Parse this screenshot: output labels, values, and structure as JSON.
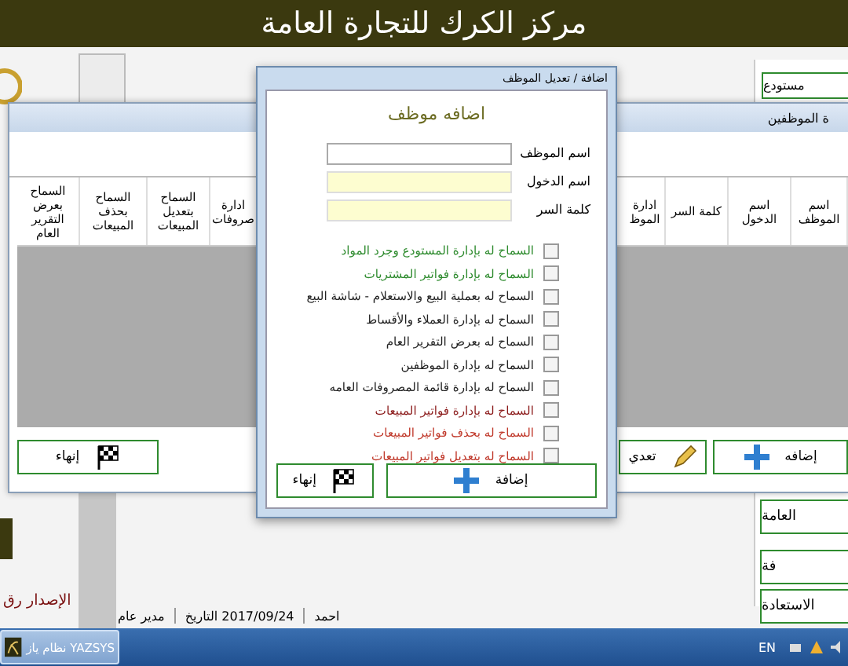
{
  "header": {
    "title": "مركز الكرك للتجارة العامة"
  },
  "background": {
    "version_text": "الإصدار رق",
    "right_panel": {
      "field_value": "مستودع",
      "buttons": [
        "العامة",
        "فة",
        "الاستعادة"
      ]
    },
    "status_bar": {
      "user": "احمد",
      "date": "2017/09/24 التاريخ",
      "role": "مدير عام"
    }
  },
  "employees_window": {
    "title": "ة الموظفين",
    "columns_right": [
      "اسم الموظف",
      "اسم الدخول",
      "كلمة السر",
      "ادارة الموظ"
    ],
    "columns_left": [
      "ادارة صروفات",
      "السماح بتعديل المبيعات",
      "السماح بحذف المبيعات",
      "السماح بعرض التقرير العام"
    ],
    "buttons": [
      {
        "kind": "add",
        "label": "إضافه"
      },
      {
        "kind": "edit",
        "label": "تعدي"
      },
      {
        "kind": "finish",
        "label": "إنهاء"
      }
    ]
  },
  "dialog": {
    "title": "اضافة / تعديل الموظف",
    "heading": "اضافه موظف",
    "fields": [
      {
        "label": "اسم الموظف",
        "highlighted": false
      },
      {
        "label": "اسم الدخول",
        "highlighted": true
      },
      {
        "label": "كلمة السر",
        "highlighted": true
      }
    ],
    "permissions": [
      {
        "label": "السماح له بإدارة المستودع وجرد المواد",
        "checked": false,
        "color": "#2e8b2e"
      },
      {
        "label": "السماح له بإدارة فواتير المشتريات",
        "checked": false,
        "color": "#2e8b2e"
      },
      {
        "label": "السماح له بعملية البيع والاستعلام - شاشة البيع",
        "checked": false,
        "color": "#222222"
      },
      {
        "label": "السماح له بإدارة العملاء والأقساط",
        "checked": false,
        "color": "#222222"
      },
      {
        "label": "السماح له بعرض التقرير العام",
        "checked": false,
        "color": "#222222"
      },
      {
        "label": "السماح له بإدارة الموظفين",
        "checked": false,
        "color": "#222222"
      },
      {
        "label": "السماح له بإدارة قائمة المصروفات العامه",
        "checked": false,
        "color": "#222222"
      },
      {
        "label": "السماح له بإدارة فواتير المبيعات",
        "checked": false,
        "color": "#8b1a1a"
      },
      {
        "label": "السماح له بحذف فواتير المبيعات",
        "checked": false,
        "color": "#c0392b"
      },
      {
        "label": "السماح له بتعديل فواتير المبيعات",
        "checked": false,
        "color": "#c0392b"
      }
    ],
    "buttons": [
      {
        "kind": "add",
        "label": "إضافة"
      },
      {
        "kind": "finish",
        "label": "إنهاء"
      }
    ]
  },
  "taskbar": {
    "app_label": "نظام ياز YAZSYS",
    "language": "EN"
  }
}
